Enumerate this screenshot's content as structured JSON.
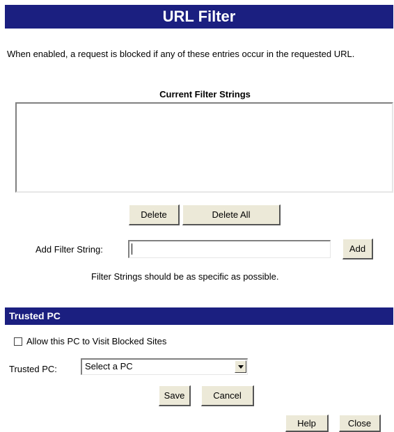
{
  "page": {
    "title": "URL Filter",
    "description": "When enabled, a request is blocked if any of these entries occur in the requested URL."
  },
  "filter_list": {
    "heading": "Current Filter Strings",
    "items": []
  },
  "buttons": {
    "delete": "Delete",
    "delete_all": "Delete All",
    "add": "Add",
    "save": "Save",
    "cancel": "Cancel",
    "help": "Help",
    "close": "Close"
  },
  "add_filter": {
    "label": "Add Filter String:",
    "value": "",
    "note": "Filter Strings should be as specific as possible."
  },
  "trusted_pc": {
    "section_title": "Trusted PC",
    "checkbox_label": "Allow this PC to Visit Blocked Sites",
    "checkbox_checked": false,
    "select_label": "Trusted PC:",
    "select_value": "Select a PC"
  }
}
